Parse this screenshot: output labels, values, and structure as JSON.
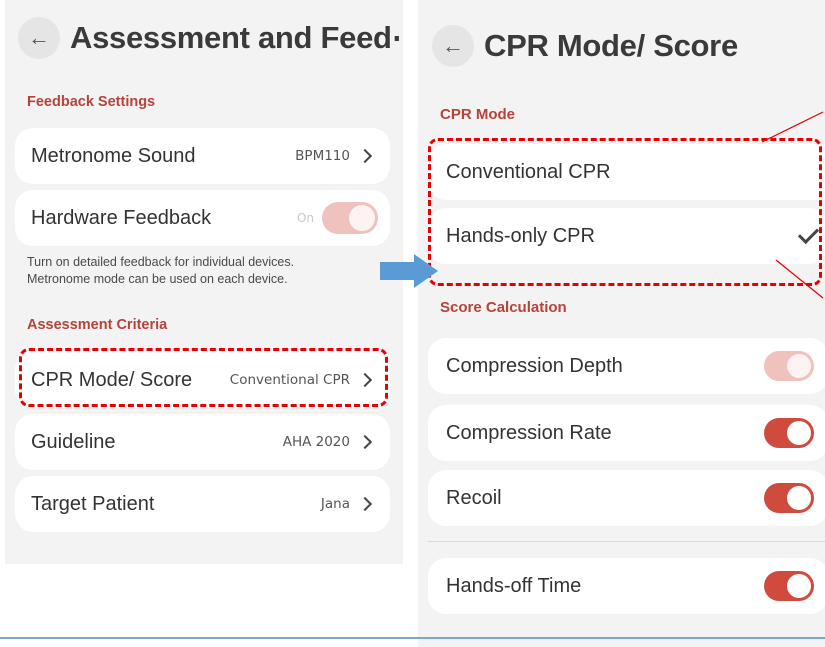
{
  "left": {
    "title": "Assessment and Feed⋯",
    "feedback_section": "Feedback Settings",
    "metronome": {
      "label": "Metronome Sound",
      "value": "BPM110"
    },
    "hardware": {
      "label": "Hardware Feedback",
      "state_label": "On"
    },
    "hardware_desc": [
      "Turn on detailed feedback for individual devices.",
      "Metronome mode can be used on each device."
    ],
    "assessment_section": "Assessment Criteria",
    "cpr_mode": {
      "label": "CPR Mode/ Score",
      "value": "Conventional CPR"
    },
    "guideline": {
      "label": "Guideline",
      "value": "AHA 2020"
    },
    "target": {
      "label": "Target Patient",
      "value": "Jana"
    }
  },
  "right": {
    "title": "CPR Mode/ Score",
    "mode_section": "CPR Mode",
    "modes": [
      "Conventional CPR",
      "Hands-only CPR"
    ],
    "selected_mode": "Hands-only CPR",
    "score_section": "Score Calculation",
    "scores": [
      {
        "label": "Compression Depth",
        "state": "on-disabled"
      },
      {
        "label": "Compression Rate",
        "state": "on"
      },
      {
        "label": "Recoil",
        "state": "on"
      }
    ],
    "hands_off": {
      "label": "Hands-off Time",
      "state": "on"
    }
  },
  "colors": {
    "accent": "#cf4b3e",
    "section_label": "#b5433a",
    "highlight": "#e60000",
    "arrow": "#5b9bd5"
  },
  "icons": {
    "back": "arrow-left-icon",
    "chevron": "chevron-right-icon",
    "check": "check-icon"
  }
}
